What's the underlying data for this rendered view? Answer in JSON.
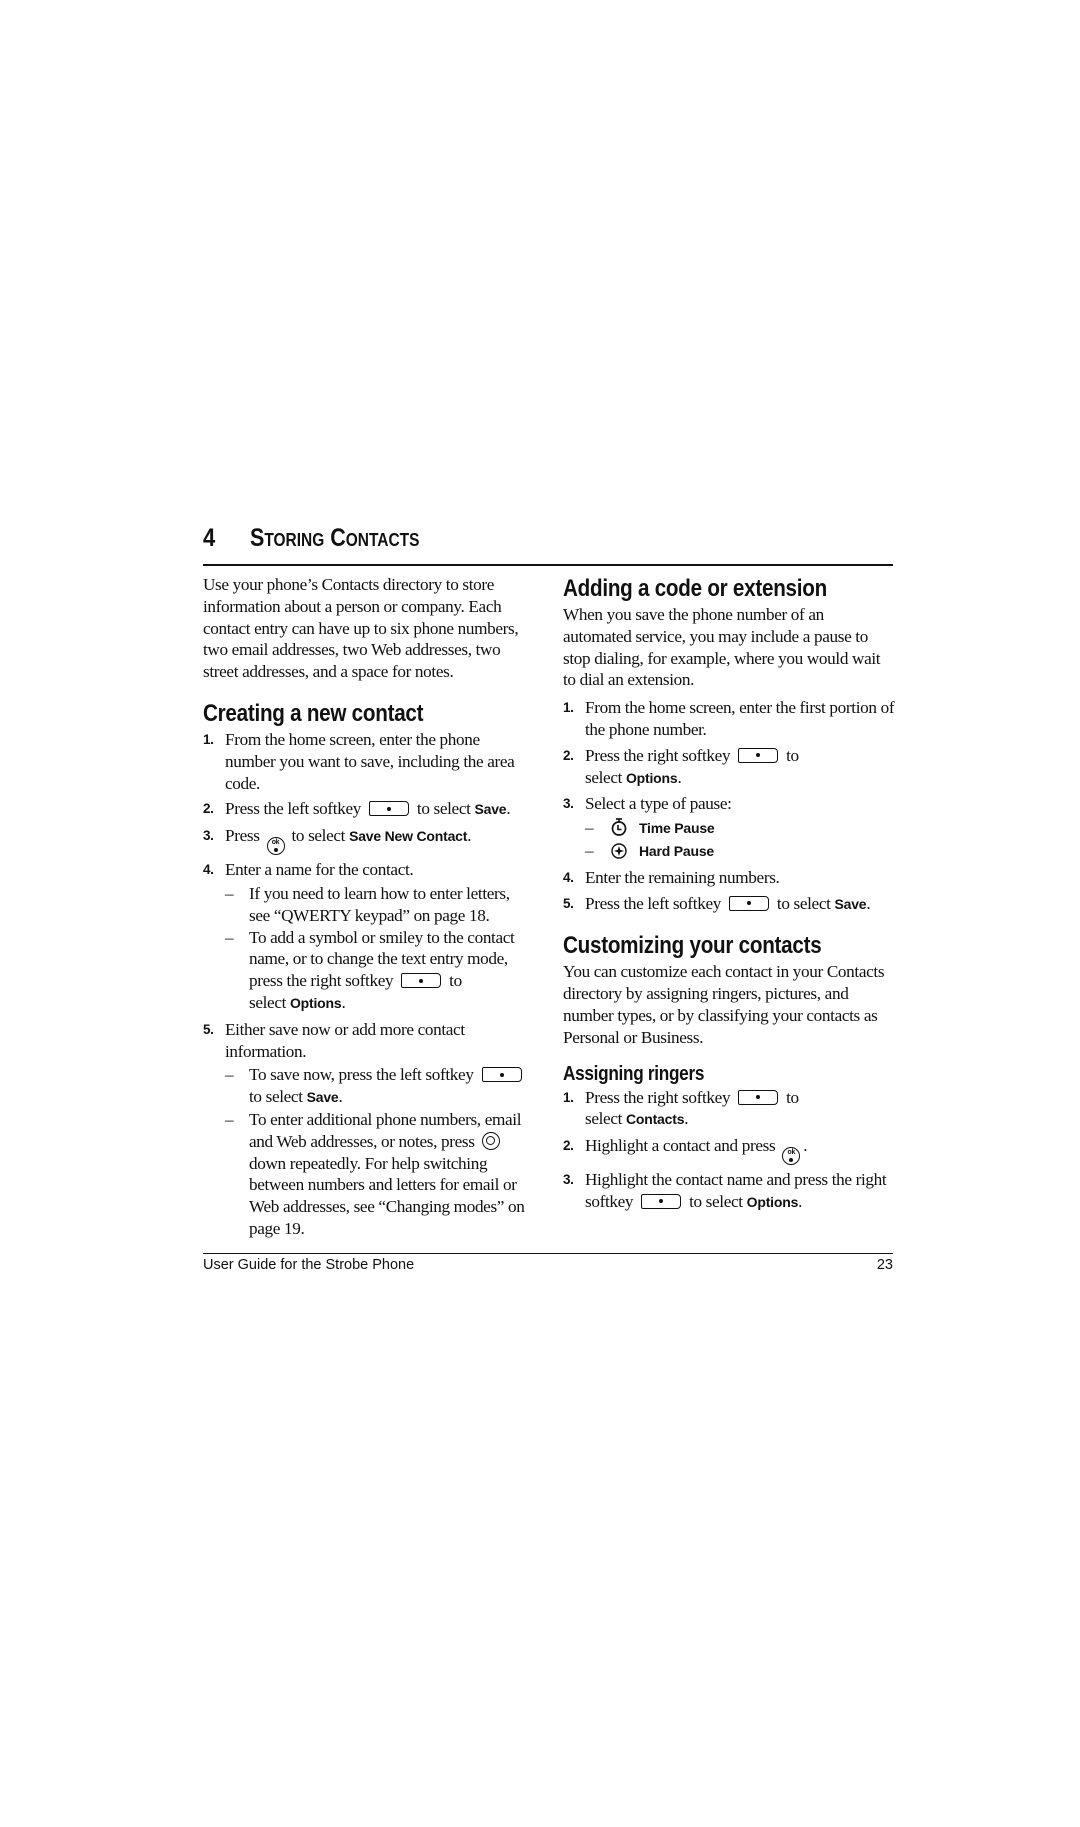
{
  "chapter": {
    "number": "4",
    "title": "Storing Contacts"
  },
  "left": {
    "intro": "Use your phone’s Contacts directory to store information about a person or company. Each contact entry can have up to six phone numbers, two email addresses, two Web addresses, two street addresses, and a space for notes.",
    "section_title": "Creating a new contact",
    "steps": [
      {
        "n": "1.",
        "text": "From the home screen, enter the phone number you want to save, including the area code."
      },
      {
        "n": "2.",
        "pre": "Press the left softkey",
        "post": "to select",
        "ui": "Save",
        "end": "."
      },
      {
        "n": "3.",
        "pre": "Press",
        "post": "to select",
        "ui": "Save New Contact",
        "end": "."
      },
      {
        "n": "4.",
        "text": "Enter a name for the contact.",
        "subs": [
          {
            "text": "If you need to learn how to enter letters, see “QWERTY keypad” on page 18."
          },
          {
            "pre": "To add a symbol or smiley to the contact name, or to change the text entry mode, press the right softkey",
            "post": "to",
            "post2": "select",
            "ui": "Options",
            "end": "."
          }
        ]
      },
      {
        "n": "5.",
        "text": "Either save now or add more contact information.",
        "subs": [
          {
            "pre": "To save now, press the left softkey",
            "post": "to select",
            "ui": "Save",
            "end": "."
          },
          {
            "pre": "To enter additional phone numbers, email and Web addresses, or notes, press",
            "post": "down repeatedly. For help switching between numbers and letters for email or Web addresses, see “Changing modes” on page 19."
          }
        ]
      }
    ]
  },
  "right": {
    "section1_title": "Adding a code or extension",
    "section1_intro": "When you save the phone number of an automated service, you may include a pause to stop dialing, for example, where you would wait to dial an extension.",
    "section1_steps": [
      {
        "n": "1.",
        "text": "From the home screen, enter the first portion of the phone number."
      },
      {
        "n": "2.",
        "pre": "Press the right softkey",
        "post": "to",
        "post2": "select",
        "ui": "Options",
        "end": "."
      },
      {
        "n": "3.",
        "text": "Select a type of pause:",
        "subs": [
          {
            "icon": "timer-icon",
            "ui": "Time Pause"
          },
          {
            "icon": "hard-pause-icon",
            "ui": "Hard Pause"
          }
        ]
      },
      {
        "n": "4.",
        "text": "Enter the remaining numbers."
      },
      {
        "n": "5.",
        "pre": "Press the left softkey",
        "post": "to select",
        "ui": "Save",
        "end": "."
      }
    ],
    "section2_title": "Customizing your contacts",
    "section2_intro": "You can customize each contact in your Contacts directory by assigning ringers, pictures, and number types, or by classifying your contacts as Personal or Business.",
    "subsection_title": "Assigning ringers",
    "subsection_steps": [
      {
        "n": "1.",
        "pre": "Press the right softkey",
        "post": "to",
        "post2": "select",
        "ui": "Contacts",
        "end": "."
      },
      {
        "n": "2.",
        "pre": "Highlight a contact and press",
        "end": "."
      },
      {
        "n": "3.",
        "pre": "Highlight the contact name and press the right softkey",
        "post": "to select",
        "ui": "Options",
        "end": "."
      }
    ]
  },
  "footer": {
    "title": "User Guide for the Strobe Phone",
    "page_number": "23"
  }
}
